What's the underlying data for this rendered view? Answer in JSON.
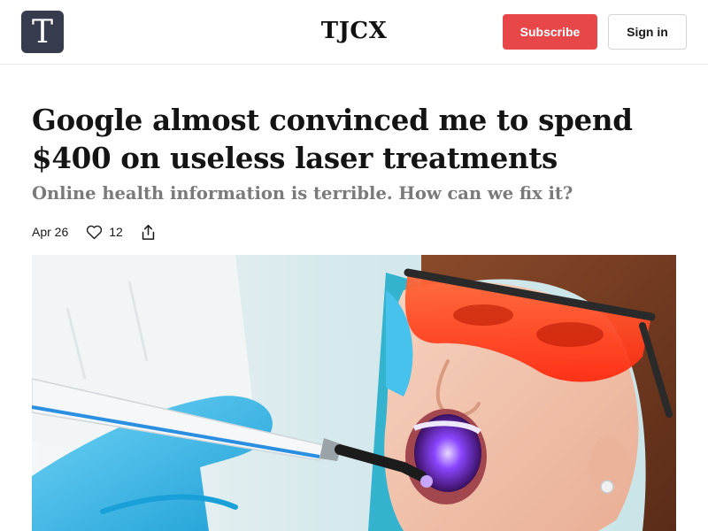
{
  "header": {
    "logo_letter": "T",
    "brand": "TJCX",
    "subscribe_label": "Subscribe",
    "signin_label": "Sign in"
  },
  "article": {
    "title": "Google almost convinced me to spend $400 on useless laser treatments",
    "subtitle": "Online health information is terrible. How can we fix it?",
    "date": "Apr 26",
    "like_count": "12"
  },
  "icons": {
    "like": "heart-icon",
    "share": "share-icon"
  },
  "colors": {
    "logo_bg": "#363c4e",
    "subscribe_bg": "#e8474a",
    "subtitle_text": "#7a7a7a",
    "glove": "#3fb8e6",
    "goggles": "#ff3b1f",
    "uv_light": "#7b35ff"
  }
}
